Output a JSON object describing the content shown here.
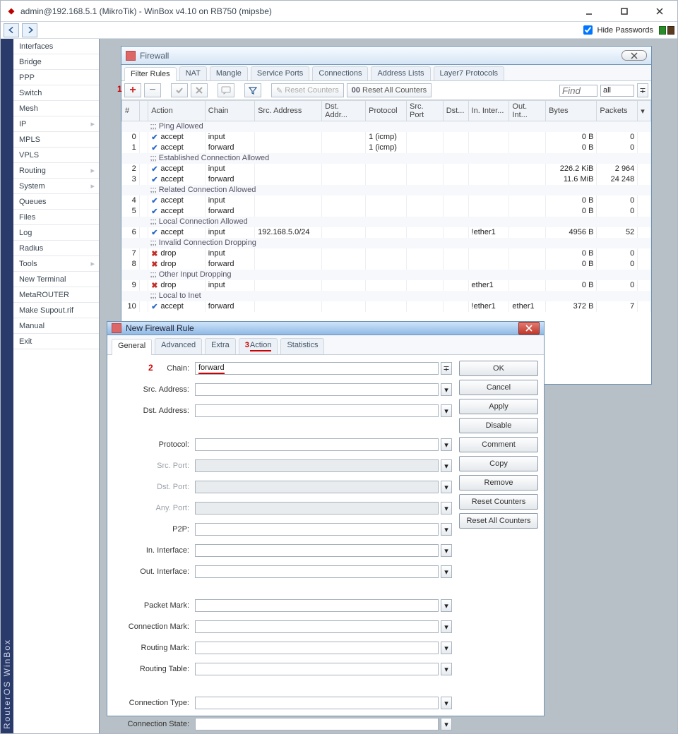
{
  "window": {
    "title": "admin@192.168.5.1 (MikroTik) - WinBox v4.10 on RB750 (mipsbe)"
  },
  "appbar": {
    "hide_passwords": "Hide Passwords"
  },
  "vlabel": "RouterOS WinBox",
  "sidebar": {
    "items": [
      {
        "label": "Interfaces",
        "expand": false
      },
      {
        "label": "Bridge",
        "expand": false
      },
      {
        "label": "PPP",
        "expand": false
      },
      {
        "label": "Switch",
        "expand": false
      },
      {
        "label": "Mesh",
        "expand": false
      },
      {
        "label": "IP",
        "expand": true
      },
      {
        "label": "MPLS",
        "expand": false
      },
      {
        "label": "VPLS",
        "expand": false
      },
      {
        "label": "Routing",
        "expand": true
      },
      {
        "label": "System",
        "expand": true
      },
      {
        "label": "Queues",
        "expand": false
      },
      {
        "label": "Files",
        "expand": false
      },
      {
        "label": "Log",
        "expand": false
      },
      {
        "label": "Radius",
        "expand": false
      },
      {
        "label": "Tools",
        "expand": true
      },
      {
        "label": "New Terminal",
        "expand": false
      },
      {
        "label": "MetaROUTER",
        "expand": false
      },
      {
        "label": "Make Supout.rif",
        "expand": false
      },
      {
        "label": "Manual",
        "expand": false
      },
      {
        "label": "Exit",
        "expand": false
      }
    ]
  },
  "firewall": {
    "title": "Firewall",
    "tabs": [
      "Filter Rules",
      "NAT",
      "Mangle",
      "Service Ports",
      "Connections",
      "Address Lists",
      "Layer7 Protocols"
    ],
    "reset_counters": "Reset Counters",
    "reset_all_counters": "Reset All Counters",
    "find_placeholder": "Find",
    "filter_dd": "all",
    "columns": [
      "#",
      "",
      "Action",
      "Chain",
      "Src. Address",
      "Dst. Addr...",
      "Protocol",
      "Src. Port",
      "Dst...",
      "In. Inter...",
      "Out. Int...",
      "Bytes",
      "Packets"
    ],
    "rows": [
      {
        "type": "comment",
        "text": ";;; Ping Allowed"
      },
      {
        "type": "rule",
        "n": "0",
        "action": "accept",
        "chain": "input",
        "src": "",
        "dst": "",
        "proto": "1 (icmp)",
        "srcport": "",
        "dstport": "",
        "in": "",
        "out": "",
        "bytes": "0 B",
        "packets": "0"
      },
      {
        "type": "rule",
        "n": "1",
        "action": "accept",
        "chain": "forward",
        "src": "",
        "dst": "",
        "proto": "1 (icmp)",
        "srcport": "",
        "dstport": "",
        "in": "",
        "out": "",
        "bytes": "0 B",
        "packets": "0"
      },
      {
        "type": "comment",
        "text": ";;; Established Connection Allowed"
      },
      {
        "type": "rule",
        "n": "2",
        "action": "accept",
        "chain": "input",
        "src": "",
        "dst": "",
        "proto": "",
        "srcport": "",
        "dstport": "",
        "in": "",
        "out": "",
        "bytes": "226.2 KiB",
        "packets": "2 964"
      },
      {
        "type": "rule",
        "n": "3",
        "action": "accept",
        "chain": "forward",
        "src": "",
        "dst": "",
        "proto": "",
        "srcport": "",
        "dstport": "",
        "in": "",
        "out": "",
        "bytes": "11.6 MiB",
        "packets": "24 248"
      },
      {
        "type": "comment",
        "text": ";;; Related Connection Allowed"
      },
      {
        "type": "rule",
        "n": "4",
        "action": "accept",
        "chain": "input",
        "src": "",
        "dst": "",
        "proto": "",
        "srcport": "",
        "dstport": "",
        "in": "",
        "out": "",
        "bytes": "0 B",
        "packets": "0"
      },
      {
        "type": "rule",
        "n": "5",
        "action": "accept",
        "chain": "forward",
        "src": "",
        "dst": "",
        "proto": "",
        "srcport": "",
        "dstport": "",
        "in": "",
        "out": "",
        "bytes": "0 B",
        "packets": "0"
      },
      {
        "type": "comment",
        "text": ";;; Local Connection Allowed"
      },
      {
        "type": "rule",
        "n": "6",
        "action": "accept",
        "chain": "input",
        "src": "192.168.5.0/24",
        "dst": "",
        "proto": "",
        "srcport": "",
        "dstport": "",
        "in": "!ether1",
        "out": "",
        "bytes": "4956 B",
        "packets": "52"
      },
      {
        "type": "comment",
        "text": ";;; Invalid Connection Dropping"
      },
      {
        "type": "rule",
        "n": "7",
        "action": "drop",
        "chain": "input",
        "src": "",
        "dst": "",
        "proto": "",
        "srcport": "",
        "dstport": "",
        "in": "",
        "out": "",
        "bytes": "0 B",
        "packets": "0"
      },
      {
        "type": "rule",
        "n": "8",
        "action": "drop",
        "chain": "forward",
        "src": "",
        "dst": "",
        "proto": "",
        "srcport": "",
        "dstport": "",
        "in": "",
        "out": "",
        "bytes": "0 B",
        "packets": "0"
      },
      {
        "type": "comment",
        "text": ";;; Other Input Dropping"
      },
      {
        "type": "rule",
        "n": "9",
        "action": "drop",
        "chain": "input",
        "src": "",
        "dst": "",
        "proto": "",
        "srcport": "",
        "dstport": "",
        "in": "ether1",
        "out": "",
        "bytes": "0 B",
        "packets": "0"
      },
      {
        "type": "comment",
        "text": ";;; Local to Inet"
      },
      {
        "type": "rule",
        "n": "10",
        "action": "accept",
        "chain": "forward",
        "src": "",
        "dst": "",
        "proto": "",
        "srcport": "",
        "dstport": "",
        "in": "!ether1",
        "out": "ether1",
        "bytes": "372 B",
        "packets": "7"
      }
    ]
  },
  "newrule": {
    "title": "New Firewall Rule",
    "tabs": [
      "General",
      "Advanced",
      "Extra",
      "Action",
      "Statistics"
    ],
    "chain_value": "forward",
    "fields": {
      "chain": "Chain:",
      "src_addr": "Src. Address:",
      "dst_addr": "Dst. Address:",
      "protocol": "Protocol:",
      "src_port": "Src. Port:",
      "dst_port": "Dst. Port:",
      "any_port": "Any. Port:",
      "p2p": "P2P:",
      "in_if": "In. Interface:",
      "out_if": "Out. Interface:",
      "pkt_mark": "Packet Mark:",
      "conn_mark": "Connection Mark:",
      "route_mark": "Routing Mark:",
      "route_table": "Routing Table:",
      "conn_type": "Connection Type:",
      "conn_state": "Connection State:"
    },
    "buttons": [
      "OK",
      "Cancel",
      "Apply",
      "Disable",
      "Comment",
      "Copy",
      "Remove",
      "Reset Counters",
      "Reset All Counters"
    ],
    "annotations": {
      "one": "1",
      "two": "2",
      "three": "3"
    }
  }
}
